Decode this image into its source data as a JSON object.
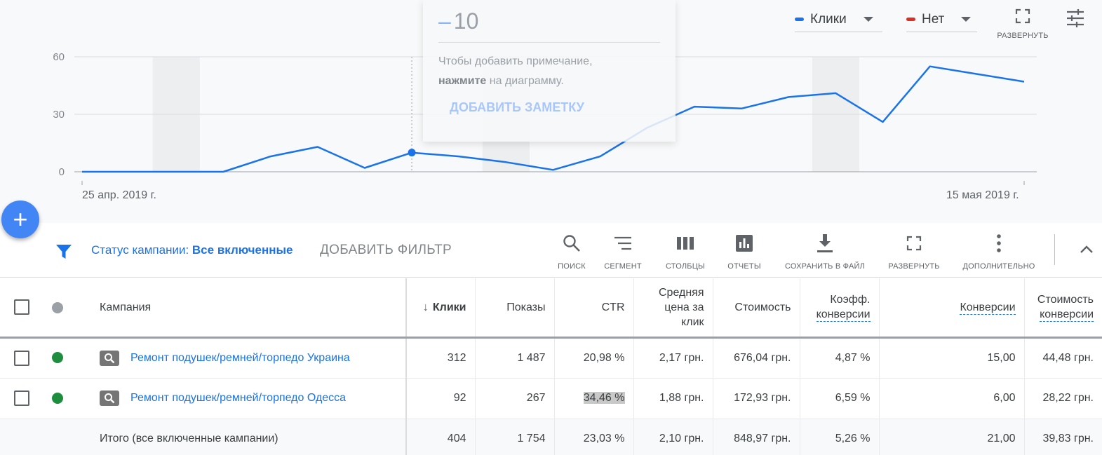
{
  "chart": {
    "y_ticks": [
      "60",
      "30",
      "0"
    ],
    "start_date": "25 апр. 2019 г.",
    "end_date": "15 мая 2019 г.",
    "metric1": {
      "label": "Клики",
      "color": "#1a73e8"
    },
    "metric2": {
      "label": "Нет",
      "color": "#d93025"
    },
    "expand_label": "РАЗВЕРНУТЬ",
    "note": {
      "minus": "–",
      "value": "10",
      "hint_prefix": "Чтобы добавить примечание,",
      "hint_bold": "нажмите",
      "hint_suffix": " на диаграмму.",
      "add_note": "ДОБАВИТЬ ЗАМЕТКУ"
    }
  },
  "chart_data": {
    "type": "line",
    "series": [
      {
        "name": "Клики",
        "values": [
          0,
          0,
          0,
          0,
          8,
          13,
          2,
          10,
          8,
          5,
          1,
          8,
          23,
          34,
          33,
          39,
          41,
          26,
          55,
          51,
          47
        ]
      }
    ],
    "x_start": "25 апр. 2019 г.",
    "x_end": "15 мая 2019 г.",
    "ylim": [
      0,
      60
    ],
    "y_ticks": [
      0,
      30,
      60
    ],
    "highlighted_index": 7,
    "grid": true
  },
  "fab": {
    "icon": "plus-icon",
    "symbol": "+"
  },
  "filter": {
    "prefix": "Статус кампании: ",
    "value": "Все включенные",
    "add_filter": "ДОБАВИТЬ ФИЛЬТР"
  },
  "toolbar": {
    "search": "ПОИСК",
    "segment": "СЕГМЕНТ",
    "columns": "СТОЛБЦЫ",
    "reports": "ОТЧЕТЫ",
    "download": "СОХРАНИТЬ В ФАЙЛ",
    "expand": "РАЗВЕРНУТЬ",
    "more": "ДОПОЛНИТЕЛЬНО"
  },
  "table": {
    "headers": {
      "campaign": "Кампания",
      "clicks": "Клики",
      "impressions": "Показы",
      "ctr": "CTR",
      "avg_cpc_1": "Средняя",
      "avg_cpc_2": "цена за",
      "avg_cpc_3": "клик",
      "cost": "Стоимость",
      "conv_rate_1": "Коэфф.",
      "conv_rate_2": "конверсии",
      "conversions": "Конверсии",
      "cost_per_conv_1": "Стоимость",
      "cost_per_conv_2": "конверсии"
    },
    "rows": [
      {
        "status_color": "#1e8e3e",
        "campaign": "Ремонт подушек/ремней/торпедо Украина",
        "clicks": "312",
        "impressions": "1 487",
        "ctr": "20,98 %",
        "avg_cpc": "2,17 грн.",
        "cost": "676,04 грн.",
        "conv_rate": "4,87 %",
        "conversions": "15,00",
        "cost_per_conv": "44,48 грн."
      },
      {
        "status_color": "#1e8e3e",
        "campaign": "Ремонт подушек/ремней/торпедо Одесса",
        "clicks": "92",
        "impressions": "267",
        "ctr": "34,46 %",
        "avg_cpc": "1,88 грн.",
        "cost": "172,93 грн.",
        "conv_rate": "6,59 %",
        "conversions": "6,00",
        "cost_per_conv": "28,22 грн."
      }
    ],
    "total": {
      "label": "Итого (все включенные кампании)",
      "clicks": "404",
      "impressions": "1 754",
      "ctr": "23,03 %",
      "avg_cpc": "2,10 грн.",
      "cost": "848,97 грн.",
      "conv_rate": "5,26 %",
      "conversions": "21,00",
      "cost_per_conv": "39,83 грн."
    }
  }
}
